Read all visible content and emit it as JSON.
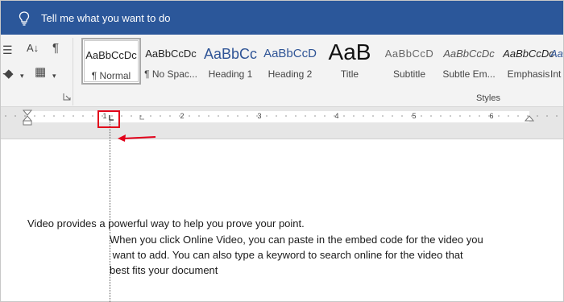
{
  "tell_me": {
    "text": "Tell me what you want to do"
  },
  "ribbon": {
    "paragraph_icons": [
      "sort-icon",
      "pilcrow-icon",
      "shading-icon",
      "borders-icon",
      "list-icon"
    ],
    "styles": [
      {
        "preview": "AaBbCcDc",
        "name": "¶ Normal",
        "selected": true
      },
      {
        "preview": "AaBbCcDc",
        "name": "¶ No Spac..."
      },
      {
        "preview": "AaBbCc",
        "name": "Heading 1"
      },
      {
        "preview": "AaBbCcD",
        "name": "Heading 2"
      },
      {
        "preview": "AaB",
        "name": "Title"
      },
      {
        "preview": "AaBbCcD",
        "name": "Subtitle"
      },
      {
        "preview": "AaBbCcDc",
        "name": "Subtle Em..."
      },
      {
        "preview": "AaBbCcDc",
        "name": "Emphasis"
      },
      {
        "preview": "AaBbCcDc",
        "name": "Int"
      }
    ],
    "group_label": "Styles"
  },
  "ruler": {
    "numbers": [
      "1",
      "2",
      "3",
      "4",
      "5",
      "6"
    ]
  },
  "document": {
    "lines": [
      "Video provides a powerful way to help you prove your point.",
      "When you click Online Video, you can paste in the embed code for the video you",
      " want to add. You can also type a keyword to search online for the video that",
      "best fits your document"
    ]
  },
  "colors": {
    "title_bar": "#2b579a",
    "annotation": "#e2001a",
    "heading_blue": "#2f5496"
  }
}
